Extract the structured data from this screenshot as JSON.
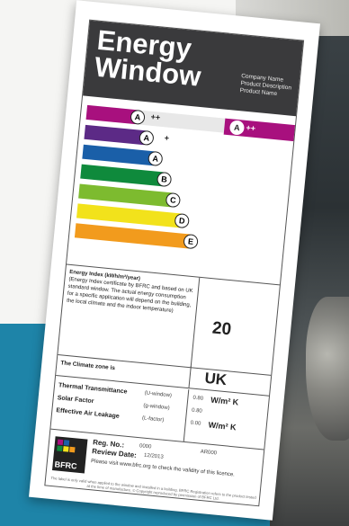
{
  "label": {
    "title_line1": "Energy",
    "title_line2": "Window",
    "company_name": "Company Name",
    "product_description": "Product Description",
    "product_name": "Product Name",
    "rating": {
      "letter": "A",
      "suffix": "++"
    },
    "bands": [
      {
        "letter": "A",
        "suffix": "++",
        "color": "#a8107e"
      },
      {
        "letter": "A",
        "suffix": "+",
        "color": "#5c2a86"
      },
      {
        "letter": "A",
        "suffix": "",
        "color": "#1a5fa8"
      },
      {
        "letter": "B",
        "suffix": "",
        "color": "#0f8a3c"
      },
      {
        "letter": "C",
        "suffix": "",
        "color": "#7dbb2f"
      },
      {
        "letter": "D",
        "suffix": "",
        "color": "#f2e21b"
      },
      {
        "letter": "E",
        "suffix": "",
        "color": "#f29b1d"
      }
    ],
    "energy_index_heading": "Energy Index (kWh/m²/year)",
    "energy_index_note": "(Energy Index certificate by BFRC and based on UK standard window. The actual energy consumption for a specific application will depend on the building, the local climate and the indoor temperature)",
    "energy_index_value": "20",
    "climate_zone_label": "The Climate zone is",
    "climate_zone_value": "UK",
    "specs": [
      {
        "name": "Thermal Transmittance",
        "sym": "(U-window)",
        "val": "0.80",
        "unit": "W/m² K"
      },
      {
        "name": "Solar Factor",
        "sym": "(g-window)",
        "val": "0.80",
        "unit": ""
      },
      {
        "name": "Effective Air Leakage",
        "sym": "(L-factor)",
        "val": "0.00",
        "unit": "W/m² K"
      }
    ],
    "reg_label": "Reg. No.:",
    "reg_value": "0000",
    "reg_code": "AR000",
    "review_label": "Review Date:",
    "review_value": "12/2013",
    "visit_text": "Please visit www.bfrc.org to check the validity of this licence.",
    "fine_print": "The label is only valid when applied to the window and installed in a building. BFRC Registration refers to the product tested at the time of manufacture. © Copyright reproduced by permission of BFRC Ltd.",
    "logo_text": "BFRC"
  }
}
